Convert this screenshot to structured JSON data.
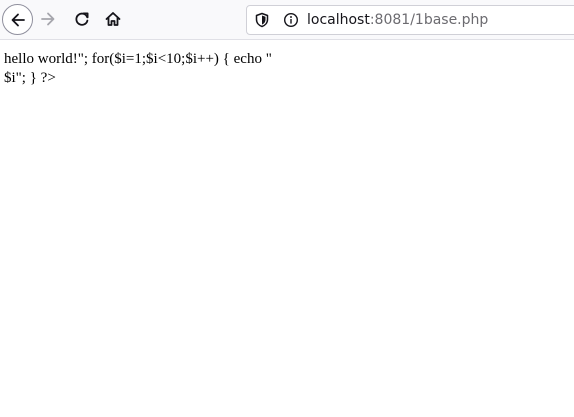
{
  "browser": {
    "url_host": "localhost",
    "url_rest": ":8081/1base.php",
    "icons": {
      "back": "arrow-left-icon",
      "forward": "arrow-right-icon",
      "reload": "reload-icon",
      "home": "home-icon",
      "tracking": "shield-icon",
      "site_info": "info-icon"
    },
    "colors": {
      "toolbar_bg": "#f9f9fb",
      "icon_active": "#15141a",
      "icon_disabled": "#a6a6ad",
      "url_host": "#15141a",
      "url_rest": "#6c6b70"
    }
  },
  "page": {
    "body_text": "hello world!\"; for($i=1;$i<10;$i++) { echo \"\n$i\"; } ?>"
  }
}
